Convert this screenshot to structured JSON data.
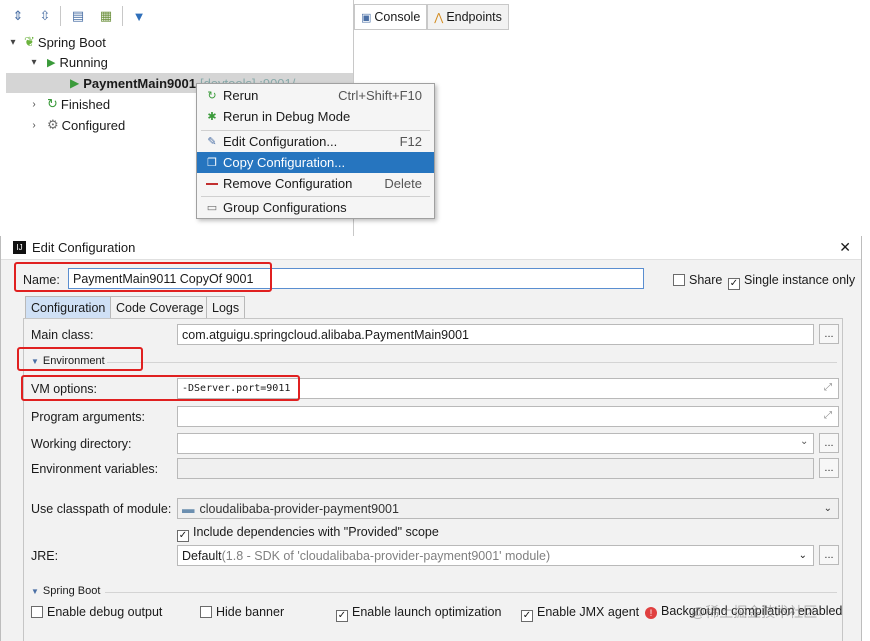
{
  "top_panel": {
    "toolbar": [
      "expand-all-icon",
      "collapse-all-icon",
      "group-by-type-icon",
      "group-by-configuration-icon",
      "filter-icon"
    ],
    "tree": {
      "spring_boot": "Spring Boot",
      "running": "Running",
      "payment_main": "PaymentMain9001",
      "payment_main_suffix": "[devtools] :9001/",
      "finished": "Finished",
      "configured": "Configured"
    },
    "tabs": {
      "console": "Console",
      "endpoints": "Endpoints"
    }
  },
  "context_menu": {
    "items": [
      {
        "label": "Rerun",
        "shortcut": "Ctrl+Shift+F10"
      },
      {
        "label": "Rerun in Debug Mode",
        "shortcut": ""
      },
      {
        "label": "Edit Configuration...",
        "shortcut": "F12"
      },
      {
        "label": "Copy Configuration...",
        "shortcut": ""
      },
      {
        "label": "Remove Configuration",
        "shortcut": "Delete"
      },
      {
        "label": "Group Configurations",
        "shortcut": ""
      }
    ],
    "selected_index": 3
  },
  "dialog": {
    "title": "Edit Configuration",
    "close": "✕",
    "name_label": "Name:",
    "name_value": "PaymentMain9011 CopyOf 9001",
    "share_label": "Share",
    "share_checked": false,
    "single_instance_label": "Single instance only",
    "single_instance_checked": true,
    "tabs": [
      "Configuration",
      "Code Coverage",
      "Logs"
    ],
    "main_class_label": "Main class:",
    "main_class_value": "com.atguigu.springcloud.alibaba.PaymentMain9001",
    "environment_section": "Environment",
    "vm_options_label": "VM options:",
    "vm_options_value": "-DServer.port=9011",
    "program_args_label": "Program arguments:",
    "working_dir_label": "Working directory:",
    "env_vars_label": "Environment variables:",
    "classpath_label": "Use classpath of module:",
    "classpath_value": "cloudalibaba-provider-payment9001",
    "include_deps_label": "Include dependencies with \"Provided\" scope",
    "include_deps_checked": true,
    "jre_label": "JRE:",
    "jre_value_main": "Default",
    "jre_value_detail": " (1.8 - SDK of 'cloudalibaba-provider-payment9001' module)",
    "spring_boot_section": "Spring Boot",
    "options": [
      {
        "label": "Enable debug output",
        "checked": false
      },
      {
        "label": "Hide banner",
        "checked": false
      },
      {
        "label": "Enable launch optimization",
        "checked": true
      },
      {
        "label": "Enable JMX agent",
        "checked": true
      }
    ],
    "background_compilation": "Background compilation enabled",
    "watermark": "@稀土掘金技术社区",
    "dots": "...",
    "accent_color": "#2675bf",
    "highlight_color": "#e02020"
  }
}
